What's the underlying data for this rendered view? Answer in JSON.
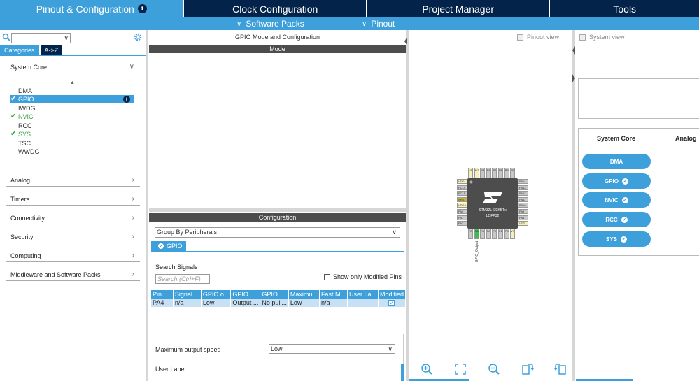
{
  "top_tabs": [
    {
      "label": "Pinout & Configuration",
      "active": true
    },
    {
      "label": "Clock Configuration"
    },
    {
      "label": "Project Manager"
    },
    {
      "label": "Tools"
    }
  ],
  "sub_menus": {
    "software_packs": "Software Packs",
    "pinout": "Pinout"
  },
  "left": {
    "search_value": "",
    "category_tabs": [
      "Categories",
      "A->Z"
    ],
    "sections": [
      "System Core",
      "Analog",
      "Timers",
      "Connectivity",
      "Security",
      "Computing",
      "Middleware and Software Packs"
    ],
    "system_core_items": [
      {
        "label": "DMA",
        "checked": false
      },
      {
        "label": "GPIO",
        "checked": true,
        "selected": true
      },
      {
        "label": "IWDG",
        "checked": false
      },
      {
        "label": "NVIC",
        "checked": true
      },
      {
        "label": "RCC",
        "checked": false
      },
      {
        "label": "SYS",
        "checked": true
      },
      {
        "label": "TSC",
        "checked": false
      },
      {
        "label": "WWDG",
        "checked": false
      }
    ]
  },
  "middle": {
    "title": "GPIO Mode and Configuration",
    "mode_header": "Mode",
    "config_header": "Configuration",
    "group_by": "Group By Peripherals",
    "gpio_tab": "GPIO",
    "search_signals_label": "Search Signals",
    "search_placeholder": "Search (Ctrl+F)",
    "show_modified": "Show only Modified Pins",
    "table": {
      "headers": [
        "Pin ...",
        "Signal ...",
        "GPIO o...",
        "GPIO ...",
        "GPIO ...",
        "Maximu...",
        "Fast M...",
        "User La...",
        "Modified"
      ],
      "rows": [
        [
          "PA4",
          "n/a",
          "Low",
          "Output ...",
          "No pull...",
          "Low",
          "n/a",
          "",
          "✓"
        ]
      ]
    },
    "max_speed_label": "Maximum output speed",
    "max_speed_value": "Low",
    "user_label_label": "User Label",
    "user_label_value": ""
  },
  "pinout": {
    "pinout_view": "Pinout view",
    "system_view": "System view",
    "chip_name": "STM32L422KBTx",
    "package": "LQFP32",
    "pa4_signal": "GPIO_Output",
    "left_pins": [
      "VDD",
      "PC14",
      "PC15",
      "NRST",
      "VDDA",
      "PA0",
      "PA1",
      "PA2"
    ],
    "right_pins": [
      "PA14",
      "PA13",
      "PA12",
      "PA11",
      "PA10",
      "PA9",
      "PA8",
      "VDD"
    ],
    "top_pins": [
      "VSS",
      "BOOT",
      "PB7",
      "PB6",
      "PB5",
      "PB4",
      "PB3",
      "PA15"
    ],
    "bottom_pins": [
      "PA3",
      "PA4",
      "PA5",
      "PA6",
      "PA7",
      "PB0",
      "PB1",
      "VSS"
    ]
  },
  "right": {
    "system_core": "System Core",
    "analog": "Analog",
    "pills": [
      "DMA",
      "GPIO",
      "NVIC",
      "RCC",
      "SYS"
    ]
  },
  "colors": {
    "accent": "#3ea0db",
    "dark": "#03234b",
    "green": "#3dbd4f"
  }
}
